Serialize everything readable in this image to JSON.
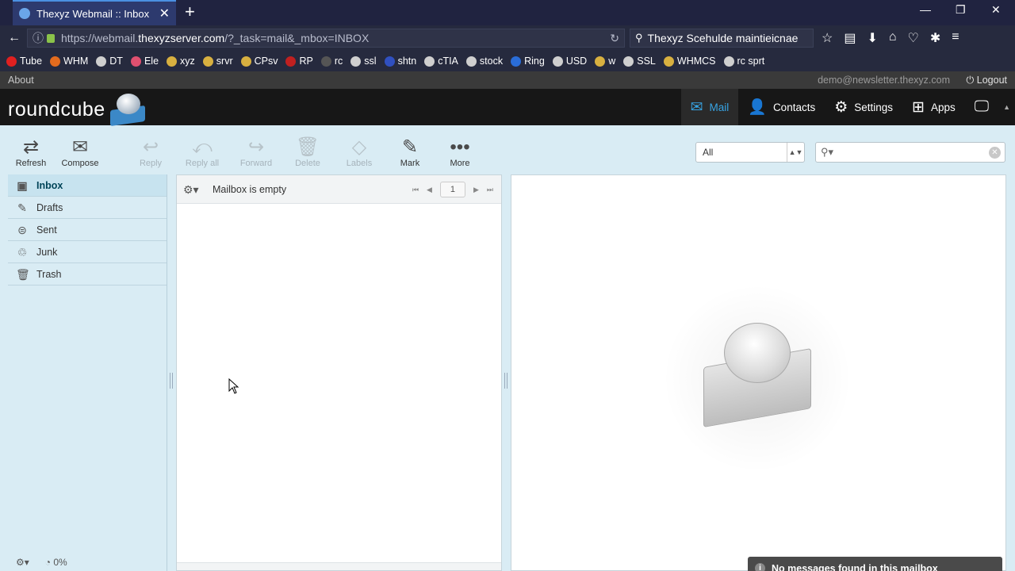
{
  "browser": {
    "tab_title": "Thexyz Webmail :: Inbox",
    "url_prefix": "https://webmail.",
    "url_domain": "thexyzserver.com",
    "url_path": "/?_task=mail&_mbox=INBOX",
    "search_text": "Thexyz Scehulde maintieicnae",
    "bookmarks": [
      "Tube",
      "WHM",
      "DT",
      "Ele",
      "xyz",
      "srvr",
      "CPsv",
      "RP",
      "rc",
      "ssl",
      "shtn",
      "cTIA",
      "stock",
      "Ring",
      "USD",
      "w",
      "SSL",
      "WHMCS",
      "rc sprt"
    ]
  },
  "app": {
    "about": "About",
    "user_email": "demo@newsletter.thexyz.com",
    "logout": "Logout",
    "logo_text": "roundcube",
    "nav": [
      {
        "label": "Mail",
        "icon": "mail-icon"
      },
      {
        "label": "Contacts",
        "icon": "contacts-icon"
      },
      {
        "label": "Settings",
        "icon": "gear-icon"
      },
      {
        "label": "Apps",
        "icon": "plus-icon"
      }
    ]
  },
  "toolbar": {
    "refresh": "Refresh",
    "compose": "Compose",
    "reply": "Reply",
    "reply_all": "Reply all",
    "forward": "Forward",
    "delete": "Delete",
    "labels": "Labels",
    "mark": "Mark",
    "more": "More",
    "filter_value": "All",
    "search_placeholder": ""
  },
  "folders": [
    {
      "label": "Inbox",
      "icon": "inbox-icon"
    },
    {
      "label": "Drafts",
      "icon": "pencil-icon"
    },
    {
      "label": "Sent",
      "icon": "sent-icon"
    },
    {
      "label": "Junk",
      "icon": "recycle-icon"
    },
    {
      "label": "Trash",
      "icon": "trash-icon"
    }
  ],
  "quota": "0%",
  "messagelist": {
    "count_text": "Mailbox is empty",
    "page": "1"
  },
  "notification": "No messages found in this mailbox",
  "colors": {
    "accent": "#37a4e4",
    "header_bg": "#171717",
    "folders_bg": "#d9ecf4"
  }
}
